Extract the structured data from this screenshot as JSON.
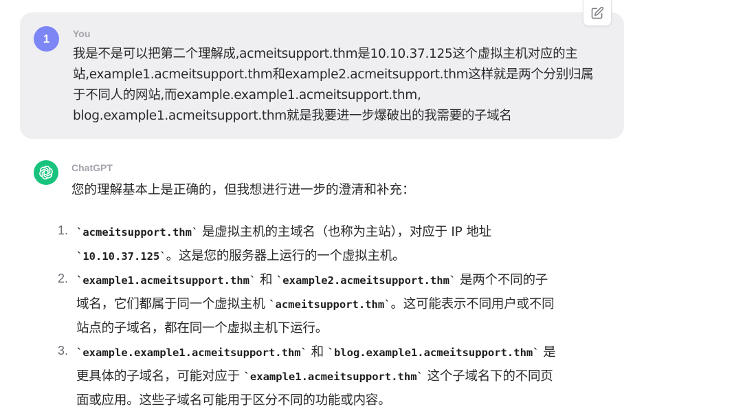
{
  "user_message": {
    "avatar_label": "1",
    "author": "You",
    "lines": [
      "我是不是可以把第二个理解成,acmeitsupport.thm是10.10.37.125这个虚拟主机对应的主",
      "站,example1.acmeitsupport.thm和example2.acmeitsupport.thm这样就是两个分别归属",
      "于不同人的网站,而example.example1.acmeitsupport.thm,",
      "blog.example1.acmeitsupport.thm就是我要进一步爆破出的我需要的子域名"
    ]
  },
  "edit_button": {
    "icon": "edit-icon"
  },
  "assistant_message": {
    "author": "ChatGPT",
    "avatar_icon": "openai-logo-icon",
    "intro": "您的理解基本上是正确的，但我想进行进一步的澄清和补充：",
    "items": [
      {
        "number": "1.",
        "lines": [
          [
            {
              "t": "code",
              "v": "`acmeitsupport.thm`"
            },
            {
              "t": "text",
              "v": " 是虚拟主机的主域名（也称为主站），对应于 IP 地址"
            }
          ],
          [
            {
              "t": "code",
              "v": "`10.10.37.125`"
            },
            {
              "t": "text",
              "v": "。这是您的服务器上运行的一个虚拟主机。"
            }
          ]
        ]
      },
      {
        "number": "2.",
        "lines": [
          [
            {
              "t": "code",
              "v": "`example1.acmeitsupport.thm`"
            },
            {
              "t": "text",
              "v": " 和 "
            },
            {
              "t": "code",
              "v": "`example2.acmeitsupport.thm`"
            },
            {
              "t": "text",
              "v": " 是两个不同的子"
            }
          ],
          [
            {
              "t": "text",
              "v": "域名，它们都属于同一个虚拟主机 "
            },
            {
              "t": "code",
              "v": "`acmeitsupport.thm`"
            },
            {
              "t": "text",
              "v": "。这可能表示不同用户或不同"
            }
          ],
          [
            {
              "t": "text",
              "v": "站点的子域名，都在同一个虚拟主机下运行。"
            }
          ]
        ]
      },
      {
        "number": "3.",
        "lines": [
          [
            {
              "t": "code",
              "v": "`example.example1.acmeitsupport.thm`"
            },
            {
              "t": "text",
              "v": " 和 "
            },
            {
              "t": "code",
              "v": "`blog.example1.acmeitsupport.thm`"
            },
            {
              "t": "text",
              "v": " 是"
            }
          ],
          [
            {
              "t": "text",
              "v": "更具体的子域名，可能对应于 "
            },
            {
              "t": "code",
              "v": "`example1.acmeitsupport.thm`"
            },
            {
              "t": "text",
              "v": " 这个子域名下的不同页"
            }
          ],
          [
            {
              "t": "text",
              "v": "面或应用。这些子域名可能用于区分不同的功能或内容。"
            }
          ]
        ]
      }
    ]
  },
  "colors": {
    "user_bubble": "#efeff2",
    "user_avatar": "#7d86f5",
    "gpt_avatar": "#19c37d",
    "author_label": "#a3a3aa"
  }
}
